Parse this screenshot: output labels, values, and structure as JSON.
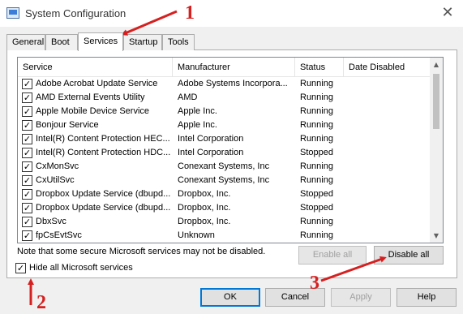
{
  "window": {
    "title": "System Configuration",
    "close_glyph": "✕",
    "icon": "msconfig-app-icon"
  },
  "tabs": [
    "General",
    "Boot",
    "Services",
    "Startup",
    "Tools"
  ],
  "active_tab": "Services",
  "columns": [
    "Service",
    "Manufacturer",
    "Status",
    "Date Disabled"
  ],
  "services": [
    {
      "checked": true,
      "name": "Adobe Acrobat Update Service",
      "manufacturer": "Adobe Systems Incorpora...",
      "status": "Running",
      "date_disabled": ""
    },
    {
      "checked": true,
      "name": "AMD External Events Utility",
      "manufacturer": "AMD",
      "status": "Running",
      "date_disabled": ""
    },
    {
      "checked": true,
      "name": "Apple Mobile Device Service",
      "manufacturer": "Apple Inc.",
      "status": "Running",
      "date_disabled": ""
    },
    {
      "checked": true,
      "name": "Bonjour Service",
      "manufacturer": "Apple Inc.",
      "status": "Running",
      "date_disabled": ""
    },
    {
      "checked": true,
      "name": "Intel(R) Content Protection HEC...",
      "manufacturer": "Intel Corporation",
      "status": "Running",
      "date_disabled": ""
    },
    {
      "checked": true,
      "name": "Intel(R) Content Protection HDC...",
      "manufacturer": "Intel Corporation",
      "status": "Stopped",
      "date_disabled": ""
    },
    {
      "checked": true,
      "name": "CxMonSvc",
      "manufacturer": "Conexant Systems, Inc",
      "status": "Running",
      "date_disabled": ""
    },
    {
      "checked": true,
      "name": "CxUtilSvc",
      "manufacturer": "Conexant Systems, Inc",
      "status": "Running",
      "date_disabled": ""
    },
    {
      "checked": true,
      "name": "Dropbox Update Service (dbupd...",
      "manufacturer": "Dropbox, Inc.",
      "status": "Stopped",
      "date_disabled": ""
    },
    {
      "checked": true,
      "name": "Dropbox Update Service (dbupd...",
      "manufacturer": "Dropbox, Inc.",
      "status": "Stopped",
      "date_disabled": ""
    },
    {
      "checked": true,
      "name": "DbxSvc",
      "manufacturer": "Dropbox, Inc.",
      "status": "Running",
      "date_disabled": ""
    },
    {
      "checked": true,
      "name": "fpCsEvtSvc",
      "manufacturer": "Unknown",
      "status": "Running",
      "date_disabled": ""
    }
  ],
  "check_glyph": "✓",
  "scroll": {
    "up_glyph": "▲",
    "down_glyph": "▼"
  },
  "note": "Note that some secure Microsoft services may not be disabled.",
  "enable_all": "Enable all",
  "disable_all": "Disable all",
  "hide_ms": {
    "label": "Hide all Microsoft services",
    "checked": true
  },
  "footer": {
    "ok": "OK",
    "cancel": "Cancel",
    "apply": "Apply",
    "help": "Help"
  },
  "annotations": {
    "step1": "1",
    "step2": "2",
    "step3": "3",
    "color": "#d62020"
  }
}
